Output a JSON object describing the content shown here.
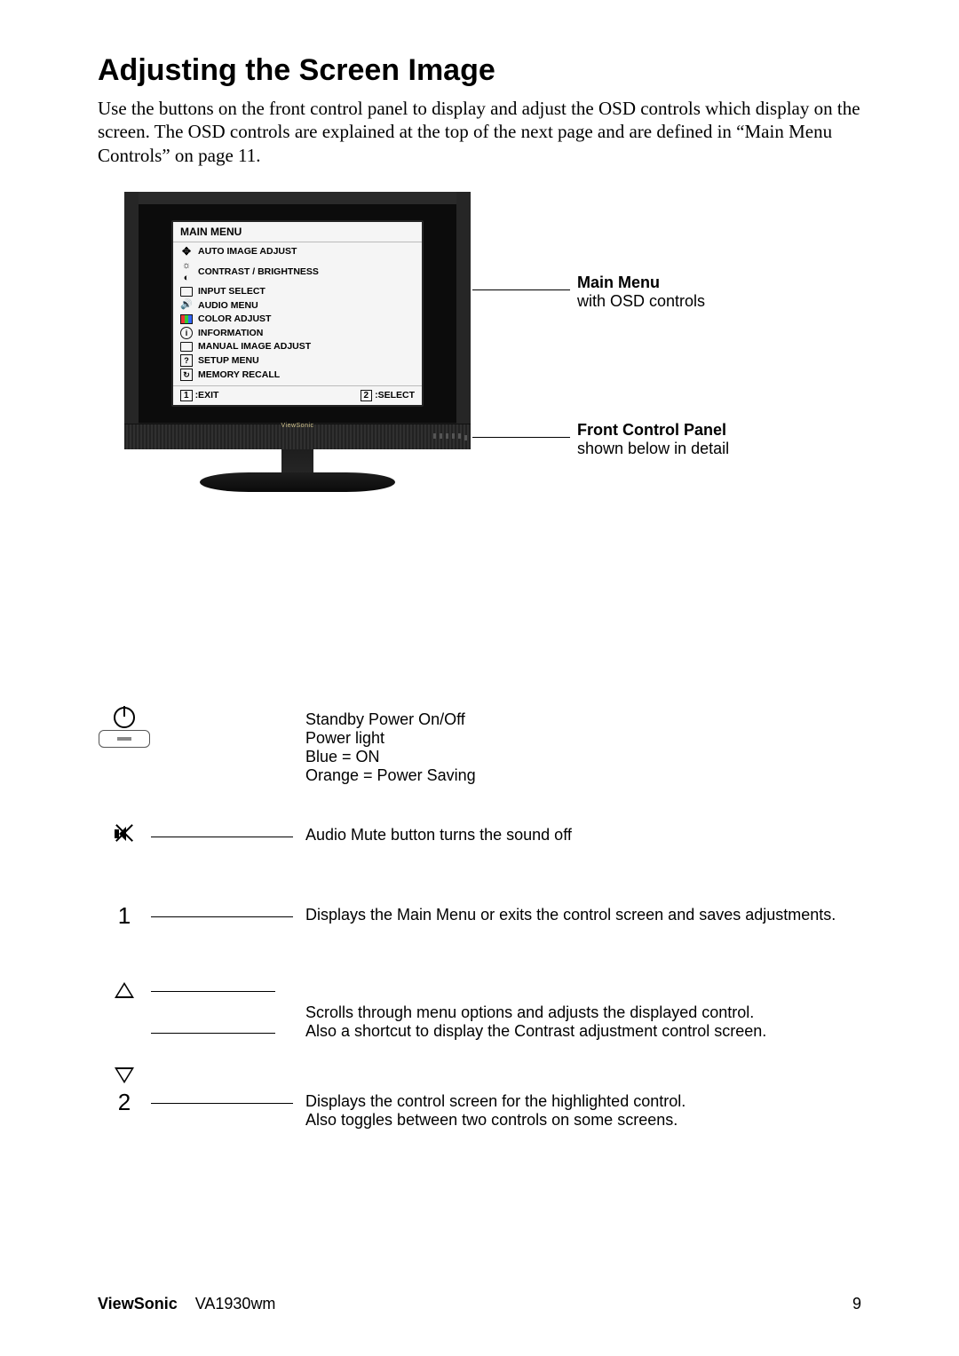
{
  "title": "Adjusting the Screen Image",
  "intro": "Use the buttons on the front control panel to display and adjust the OSD controls which display on the screen. The OSD controls are explained at the top of the next page and are defined in “Main Menu Controls” on page 11.",
  "osd": {
    "title": "MAIN MENU",
    "items": [
      "AUTO IMAGE ADJUST",
      "CONTRAST / BRIGHTNESS",
      "INPUT SELECT",
      "AUDIO MENU",
      "COLOR ADJUST",
      "INFORMATION",
      "MANUAL IMAGE ADJUST",
      "SETUP MENU",
      "MEMORY RECALL"
    ],
    "footer_left": ":EXIT",
    "footer_right": ":SELECT",
    "footer_key_left": "1",
    "footer_key_right": "2"
  },
  "monitor_labels": {
    "main_menu_title": "Main Menu",
    "main_menu_sub": "with OSD controls",
    "panel_title": "Front Control Panel",
    "panel_sub": "shown below in detail"
  },
  "controls": {
    "power": {
      "l1": "Standby Power On/Off",
      "l2": "Power light",
      "l3": "Blue = ON",
      "l4": "Orange = Power Saving"
    },
    "mute": "Audio Mute button turns the sound off",
    "btn1": "Displays the Main Menu or exits the control screen and saves adjustments.",
    "arrows_l1": "Scrolls through menu options and adjusts the displayed control.",
    "arrows_l2": "Also a shortcut to display the Contrast adjustment control screen.",
    "btn2_l1": "Displays the control screen for the highlighted control.",
    "btn2_l2": "Also toggles between two controls on some screens."
  },
  "footer": {
    "brand": "ViewSonic",
    "model": "VA1930wm",
    "page": "9"
  }
}
